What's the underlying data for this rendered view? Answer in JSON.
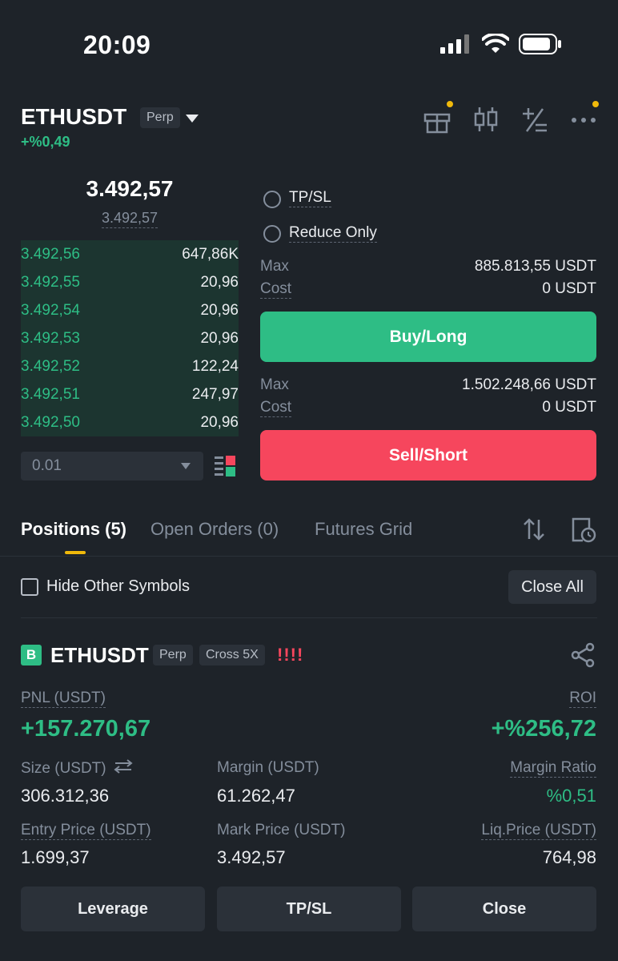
{
  "status_bar": {
    "time": "20:09"
  },
  "header": {
    "symbol": "ETHUSDT",
    "badge": "Perp",
    "change": "+%0,49",
    "icons": [
      "gift-icon",
      "candlestick-icon",
      "calculator-icon",
      "more-icon"
    ]
  },
  "order_book": {
    "last_price": "3.492,57",
    "mark_price": "3.492,57",
    "rows": [
      {
        "price": "3.492,56",
        "qty": "647,86K"
      },
      {
        "price": "3.492,55",
        "qty": "20,96"
      },
      {
        "price": "3.492,54",
        "qty": "20,96"
      },
      {
        "price": "3.492,53",
        "qty": "20,96"
      },
      {
        "price": "3.492,52",
        "qty": "122,24"
      },
      {
        "price": "3.492,51",
        "qty": "247,97"
      },
      {
        "price": "3.492,50",
        "qty": "20,96"
      }
    ],
    "precision": "0.01"
  },
  "order_panel": {
    "tpsl_label": "TP/SL",
    "reduce_only_label": "Reduce Only",
    "buy": {
      "max_label": "Max",
      "max_value": "885.813,55 USDT",
      "cost_label": "Cost",
      "cost_value": "0 USDT",
      "button": "Buy/Long"
    },
    "sell": {
      "max_label": "Max",
      "max_value": "1.502.248,66 USDT",
      "cost_label": "Cost",
      "cost_value": "0 USDT",
      "button": "Sell/Short"
    }
  },
  "tabs": [
    {
      "label": "Positions (5)"
    },
    {
      "label": "Open Orders (0)"
    },
    {
      "label": "Futures Grid"
    }
  ],
  "positions": {
    "hide_label": "Hide Other Symbols",
    "close_all": "Close All",
    "item": {
      "side": "B",
      "symbol": "ETHUSDT",
      "tag1": "Perp",
      "tag2": "Cross 5X",
      "risk": "!!!!",
      "pnl_label": "PNL (USDT)",
      "pnl_value": "+157.270,67",
      "roi_label": "ROI",
      "roi_value": "+%256,72",
      "size_label": "Size (USDT)",
      "size_value": "306.312,36",
      "margin_label": "Margin (USDT)",
      "margin_value": "61.262,47",
      "margin_ratio_label": "Margin Ratio",
      "margin_ratio_value": "%0,51",
      "entry_label": "Entry Price (USDT)",
      "entry_value": "1.699,37",
      "mark_label": "Mark Price (USDT)",
      "mark_value": "3.492,57",
      "liq_label": "Liq.Price (USDT)",
      "liq_value": "764,98"
    },
    "buttons": {
      "leverage": "Leverage",
      "tpsl": "TP/SL",
      "close": "Close"
    }
  },
  "colors": {
    "green": "#2ebd85",
    "red": "#f6465d",
    "accent": "#f0b90b",
    "bg": "#1e2329"
  }
}
